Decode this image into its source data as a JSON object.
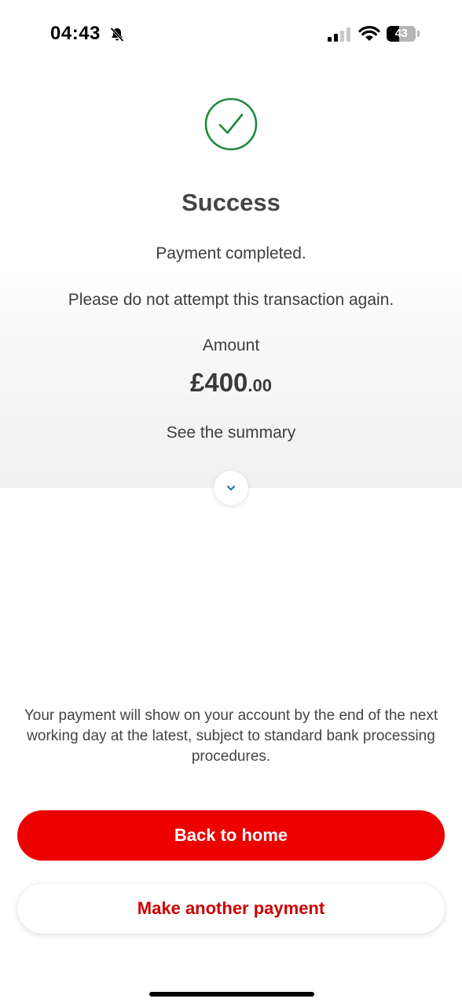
{
  "status_bar": {
    "time": "04:43",
    "battery_level": "43",
    "icons": [
      "bell-slash-icon",
      "signal-icon",
      "wifi-icon",
      "battery-icon"
    ]
  },
  "result": {
    "icon": "check-circle-icon",
    "title": "Success",
    "message": "Payment completed.",
    "warning": "Please do not attempt this transaction again.",
    "amount_label": "Amount",
    "amount_main": "£400",
    "amount_decimals": ".00",
    "summary_link": "See the summary",
    "expand_icon": "chevron-down-icon"
  },
  "info": {
    "text": "Your payment will show on your account by the end of the next working day at the latest, subject to standard bank processing procedures."
  },
  "actions": {
    "primary_label": "Back to home",
    "secondary_label": "Make another payment"
  },
  "colors": {
    "brand_red": "#ec0000",
    "success_green": "#1e8a3c",
    "chevron_teal": "#1f7a8c"
  }
}
